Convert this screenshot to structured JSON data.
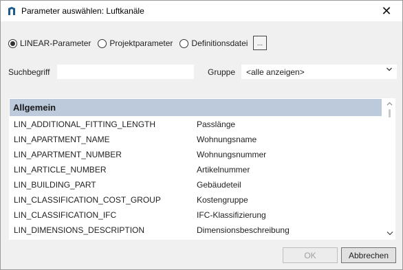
{
  "window": {
    "title": "Parameter auswählen: Luftkanäle",
    "close_glyph": "✕"
  },
  "source_options": [
    {
      "label": "LINEAR-Parameter",
      "selected": true
    },
    {
      "label": "Projektparameter",
      "selected": false
    },
    {
      "label": "Definitionsdatei",
      "selected": false
    }
  ],
  "browse_button": {
    "label": "..."
  },
  "search": {
    "label": "Suchbegriff",
    "value": ""
  },
  "group": {
    "label": "Gruppe",
    "selected": "<alle anzeigen>"
  },
  "list": {
    "section_header": "Allgemein",
    "rows": [
      {
        "name": "LIN_ADDITIONAL_FITTING_LENGTH",
        "description": "Passlänge"
      },
      {
        "name": "LIN_APARTMENT_NAME",
        "description": "Wohnungsname"
      },
      {
        "name": "LIN_APARTMENT_NUMBER",
        "description": "Wohnungsnummer"
      },
      {
        "name": "LIN_ARTICLE_NUMBER",
        "description": "Artikelnummer"
      },
      {
        "name": "LIN_BUILDING_PART",
        "description": "Gebäudeteil"
      },
      {
        "name": "LIN_CLASSIFICATION_COST_GROUP",
        "description": "Kostengruppe"
      },
      {
        "name": "LIN_CLASSIFICATION_IFC",
        "description": "IFC-Klassifizierung"
      },
      {
        "name": "LIN_DIMENSIONS_DESCRIPTION",
        "description": "Dimensionsbeschreibung"
      }
    ]
  },
  "buttons": {
    "ok": "OK",
    "cancel": "Abbrechen"
  },
  "colors": {
    "section_header_bg": "#bccadb",
    "app_icon": "#1e5a8c"
  }
}
